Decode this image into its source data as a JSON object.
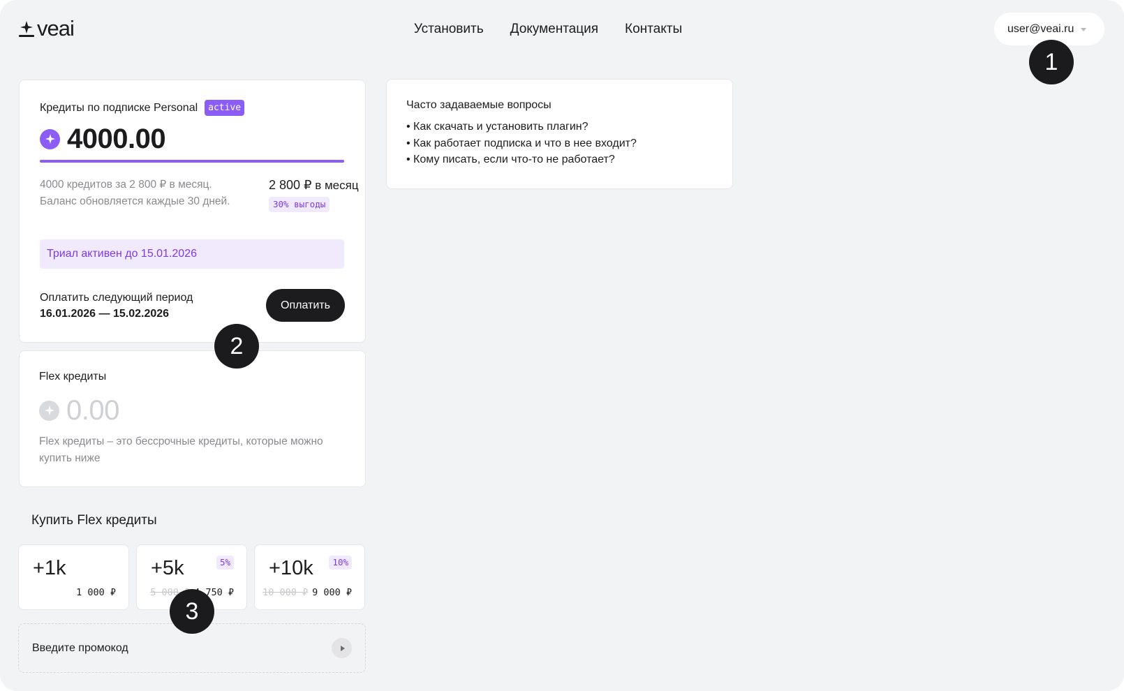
{
  "header": {
    "logo_text": "veai",
    "nav": [
      "Установить",
      "Документация",
      "Контакты"
    ],
    "user_email": "user@veai.ru"
  },
  "subscription": {
    "title": "Кредиты по подписке Personal",
    "status_badge": "active",
    "balance": "4000.00",
    "progress_fraction": 1.0,
    "description": "4000 кредитов за 2 800 ₽ в месяц. Баланс обновляется каждые 30 дней.",
    "price_amount": "2 800 ₽",
    "price_period": "в месяц",
    "savings_badge": "30% выгоды",
    "trial_notice": "Триал активен до 15.01.2026",
    "next_period_label": "Оплатить следующий период",
    "next_period_dates": "16.01.2026 — 15.02.2026",
    "pay_button": "Оплатить"
  },
  "flex": {
    "title": "Flex кредиты",
    "balance": "0.00",
    "description": "Flex кредиты – это бессрочные кредиты, которые можно купить ниже"
  },
  "faq": {
    "title": "Часто задаваемые вопросы",
    "items": [
      "• Как скачать и установить плагин?",
      "• Как работает подписка и что в нее входит?",
      "• Кому писать, если что-то не работает?"
    ]
  },
  "buy": {
    "heading": "Купить Flex кредиты",
    "packs": [
      {
        "amount": "+1k",
        "discount": "",
        "old_price": "",
        "price": "1 000 ₽"
      },
      {
        "amount": "+5k",
        "discount": "5%",
        "old_price": "5 000 ₽",
        "price": "4 750 ₽"
      },
      {
        "amount": "+10k",
        "discount": "10%",
        "old_price": "10 000 ₽",
        "price": "9 000 ₽"
      }
    ],
    "promo_placeholder": "Введите промокод"
  },
  "markers": [
    "1",
    "2",
    "3"
  ],
  "colors": {
    "accent": "#8b5cf6",
    "accent_text": "#7c3aed",
    "accent_bg": "#f1eafd",
    "dark_button": "#1c1c1e",
    "page_bg": "#f2f3f5"
  }
}
